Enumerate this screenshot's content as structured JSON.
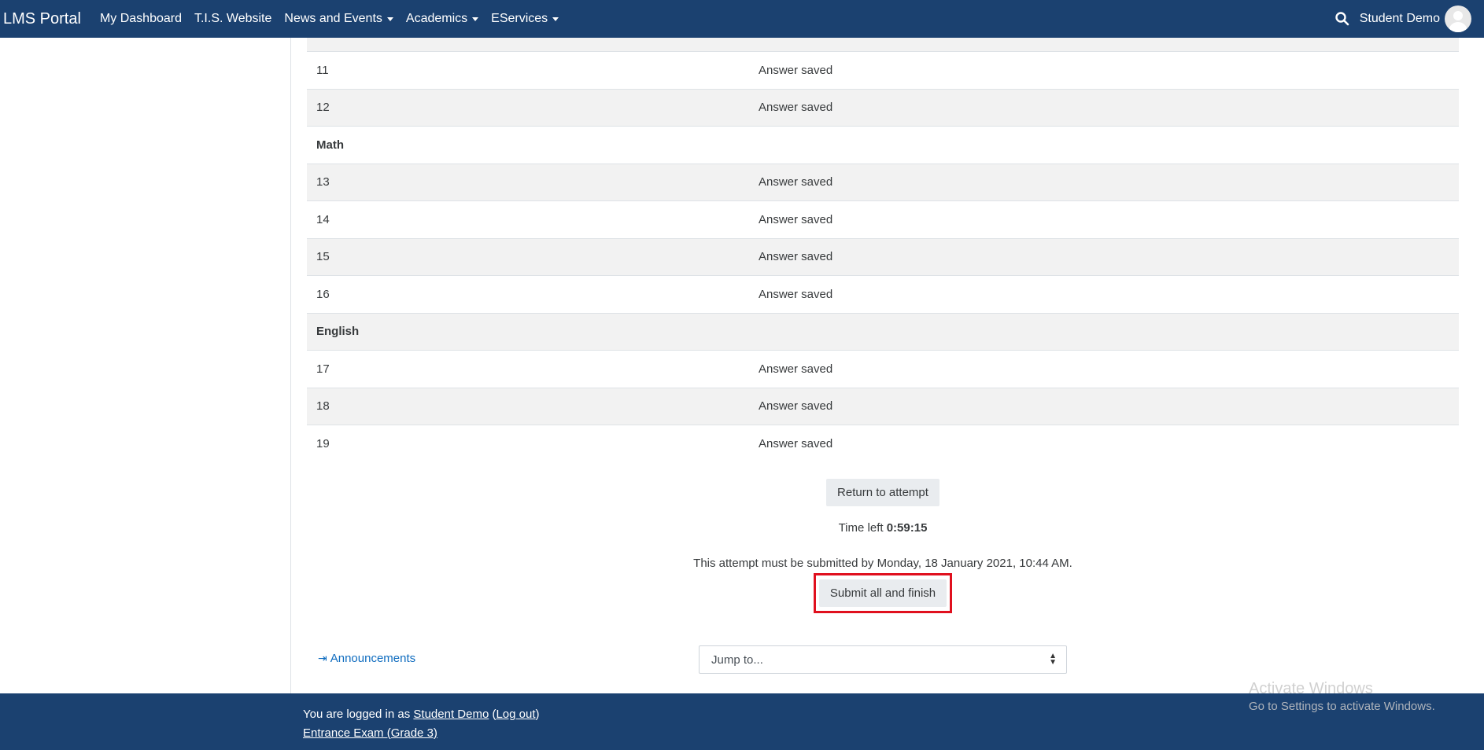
{
  "navbar": {
    "brand": "LMS Portal",
    "items": [
      {
        "label": "My Dashboard",
        "dropdown": false
      },
      {
        "label": "T.I.S. Website",
        "dropdown": false
      },
      {
        "label": "News and Events",
        "dropdown": true
      },
      {
        "label": "Academics",
        "dropdown": true
      },
      {
        "label": "EServices",
        "dropdown": true
      }
    ],
    "user_name": "Student Demo"
  },
  "summary": {
    "rows": [
      {
        "q": "11",
        "status": "Answer saved"
      },
      {
        "q": "12",
        "status": "Answer saved"
      },
      {
        "section": "Math"
      },
      {
        "q": "13",
        "status": "Answer saved"
      },
      {
        "q": "14",
        "status": "Answer saved"
      },
      {
        "q": "15",
        "status": "Answer saved"
      },
      {
        "q": "16",
        "status": "Answer saved"
      },
      {
        "section": "English"
      },
      {
        "q": "17",
        "status": "Answer saved"
      },
      {
        "q": "18",
        "status": "Answer saved"
      },
      {
        "q": "19",
        "status": "Answer saved"
      }
    ]
  },
  "actions": {
    "return_label": "Return to attempt",
    "time_left_label": "Time left",
    "time_left_value": "0:59:15",
    "deadline_text": "This attempt must be submitted by Monday, 18 January 2021, 10:44 AM.",
    "submit_label": "Submit all and finish"
  },
  "bottom_nav": {
    "announcements_label": "Announcements",
    "jump_placeholder": "Jump to..."
  },
  "footer": {
    "logged_in_prefix": "You are logged in as",
    "user_link": "Student Demo",
    "logout_label": "Log out",
    "course_link": "Entrance Exam (Grade 3)"
  },
  "watermark": {
    "title": "Activate Windows",
    "subtitle": "Go to Settings to activate Windows."
  },
  "colors": {
    "navbar_bg": "#1b4170",
    "link": "#0f6cbf",
    "highlight_box": "#e0101e"
  }
}
